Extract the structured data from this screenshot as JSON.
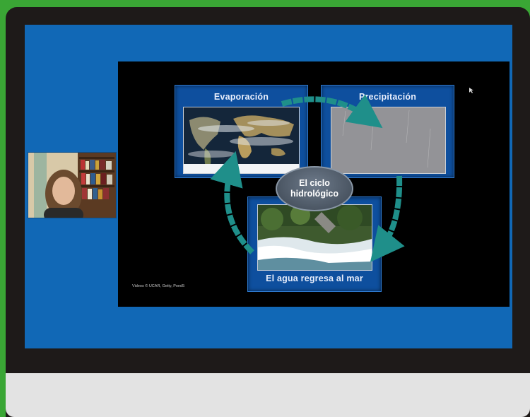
{
  "slide": {
    "panels": {
      "evaporation_title": "Evaporación",
      "precipitation_title": "Precipitación",
      "return_title": "El agua regresa al mar"
    },
    "hub": {
      "line1": "El ciclo",
      "line2": "hidrológico"
    },
    "credit": "Videos © UCAR, Getty, Pond5"
  },
  "colors": {
    "screen_background": "#1168b6",
    "panel_background": "#0e4f9e",
    "arrow_color": "#1f8f8a",
    "frame_green": "#3aa635"
  }
}
